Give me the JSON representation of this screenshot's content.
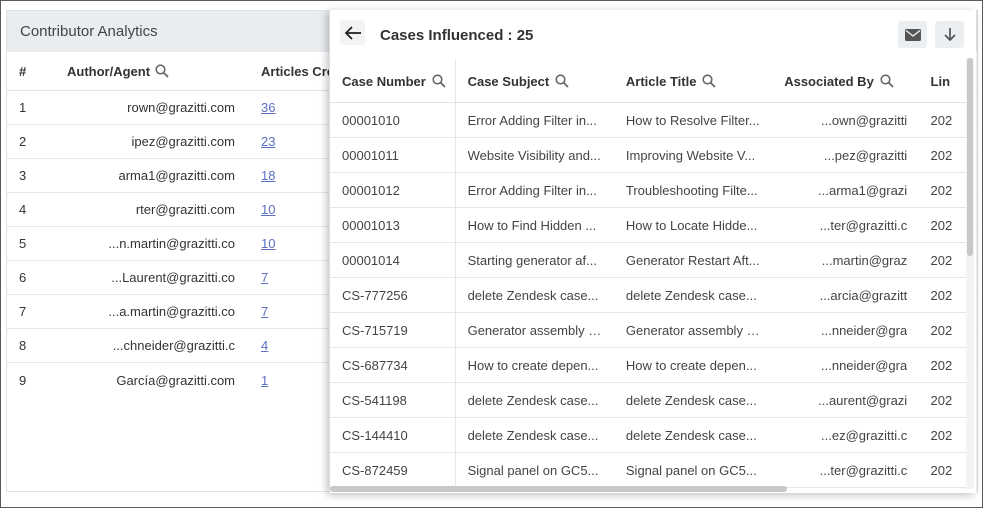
{
  "background": {
    "title": "Contributor Analytics",
    "columns": [
      "#",
      "Author/Agent",
      "Articles Cre"
    ],
    "rows": [
      {
        "num": "1",
        "author": "rown@grazitti.com",
        "articles": "36"
      },
      {
        "num": "2",
        "author": "ipez@grazitti.com",
        "articles": "23"
      },
      {
        "num": "3",
        "author": "arma1@grazitti.com",
        "articles": "18"
      },
      {
        "num": "4",
        "author": "rter@grazitti.com",
        "articles": "10"
      },
      {
        "num": "5",
        "author": "n.martin@grazitti.co...",
        "articles": "10"
      },
      {
        "num": "6",
        "author": "Laurent@grazitti.co...",
        "articles": "7"
      },
      {
        "num": "7",
        "author": "a.martin@grazitti.co...",
        "articles": "7"
      },
      {
        "num": "8",
        "author": "chneider@grazitti.c...",
        "articles": "4"
      },
      {
        "num": "9",
        "author": "García@grazitti.com",
        "articles": "1"
      }
    ]
  },
  "overlay": {
    "title": "Cases Influenced : 25",
    "columns": {
      "case_number": "Case Number",
      "case_subject": "Case Subject",
      "article_title": "Article Title",
      "associated_by": "Associated By",
      "linked": "Lin"
    },
    "rows": [
      {
        "case": "00001010",
        "subject": "Error Adding Filter in...",
        "article": "How to Resolve Filter...",
        "assoc": "own@grazitti...",
        "linked": "202"
      },
      {
        "case": "00001011",
        "subject": "Website Visibility and...",
        "article": "Improving Website V...",
        "assoc": "pez@grazitti...",
        "linked": "202"
      },
      {
        "case": "00001012",
        "subject": "Error Adding Filter in...",
        "article": "Troubleshooting Filte...",
        "assoc": "arma1@grazi...",
        "linked": "202"
      },
      {
        "case": "00001013",
        "subject": "How to Find Hidden ...",
        "article": "How to Locate Hidde...",
        "assoc": "ter@grazitti.c...",
        "linked": "202"
      },
      {
        "case": "00001014",
        "subject": "Starting generator af...",
        "article": "Generator Restart Aft...",
        "assoc": "martin@graz...",
        "linked": "202"
      },
      {
        "case": "CS-777256",
        "subject": "delete Zendesk case...",
        "article": "delete Zendesk case...",
        "assoc": "arcia@grazitt...",
        "linked": "202"
      },
      {
        "case": "CS-715719",
        "subject": "Generator assembly i...",
        "article": "Generator assembly i...",
        "assoc": "nneider@gra...",
        "linked": "202"
      },
      {
        "case": "CS-687734",
        "subject": "How to create depen...",
        "article": "How to create depen...",
        "assoc": "nneider@gra...",
        "linked": "202"
      },
      {
        "case": "CS-541198",
        "subject": "delete Zendesk case...",
        "article": "delete Zendesk case...",
        "assoc": "aurent@grazi...",
        "linked": "202"
      },
      {
        "case": "CS-144410",
        "subject": "delete Zendesk case...",
        "article": "delete Zendesk case...",
        "assoc": "ez@grazitti.c...",
        "linked": "202"
      },
      {
        "case": "CS-872459",
        "subject": "Signal panel on GC5...",
        "article": "Signal panel on GC5...",
        "assoc": "ter@grazitti.c...",
        "linked": "202"
      }
    ]
  },
  "colors": {
    "accent_link": "#5b6fbf",
    "header_bg": "#e9edf0"
  },
  "icons": {
    "back": "arrow-left-icon",
    "mail": "mail-icon",
    "download": "download-icon",
    "search": "search-icon"
  }
}
